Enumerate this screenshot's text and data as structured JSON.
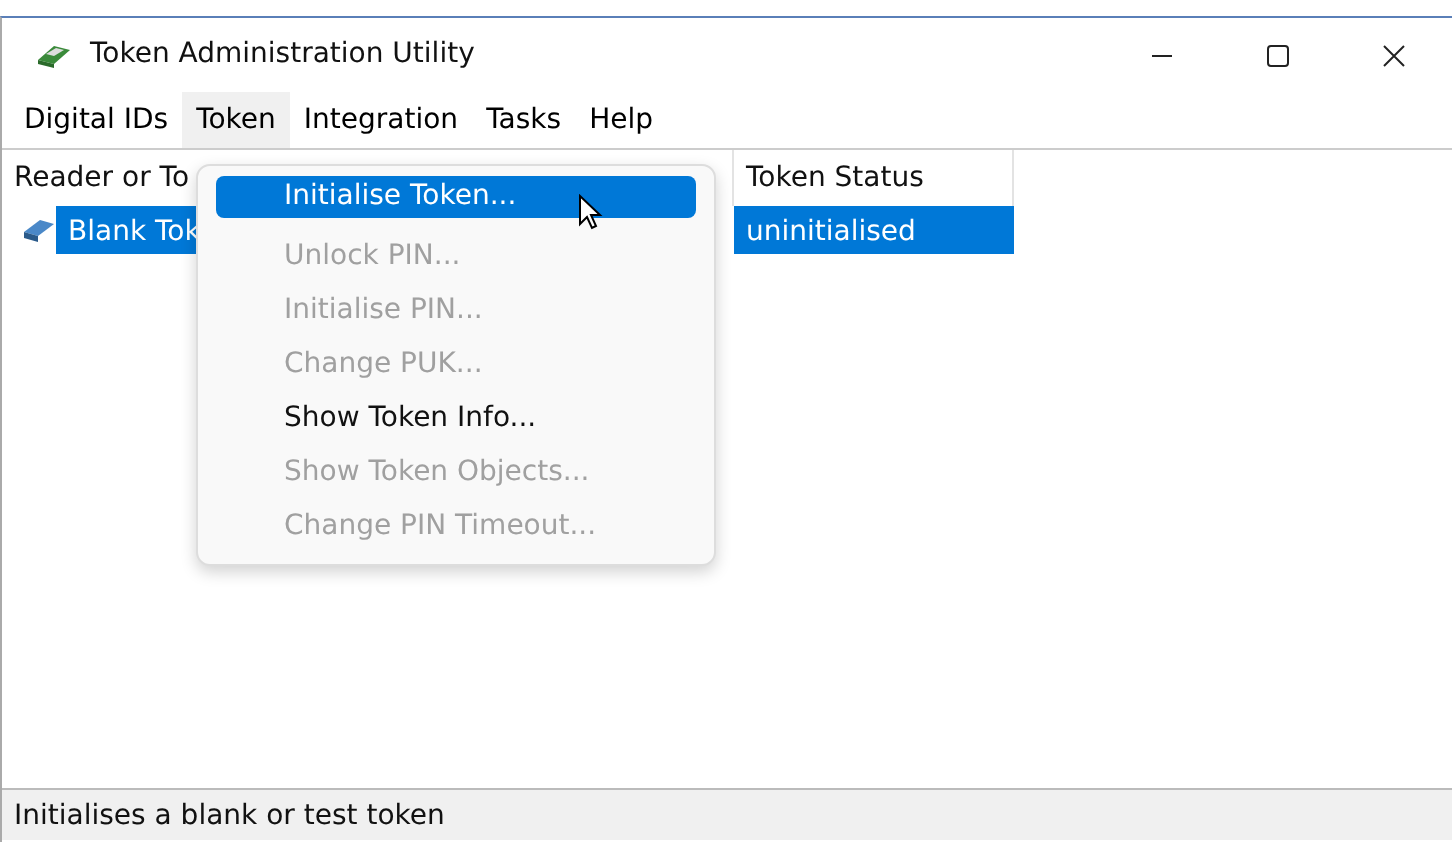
{
  "window": {
    "title": "Token Administration Utility"
  },
  "menu_bar": [
    {
      "label": "Digital IDs",
      "selected": false
    },
    {
      "label": "Token",
      "selected": true
    },
    {
      "label": "Integration",
      "selected": false
    },
    {
      "label": "Tasks",
      "selected": false
    },
    {
      "label": "Help",
      "selected": false
    }
  ],
  "table": {
    "columns": [
      "Reader or To",
      "Token Status"
    ],
    "rows": [
      {
        "cells": [
          "Blank Tok",
          "uninitialised"
        ],
        "selected": true
      }
    ]
  },
  "token_menu": [
    {
      "label": "Initialise Token...",
      "selected": true,
      "disabled": false
    },
    {
      "label": "Unlock PIN...",
      "selected": false,
      "disabled": true
    },
    {
      "label": "Initialise PIN...",
      "selected": false,
      "disabled": true
    },
    {
      "label": "Change PUK...",
      "selected": false,
      "disabled": true
    },
    {
      "label": "Show Token Info...",
      "selected": false,
      "disabled": false
    },
    {
      "label": "Show Token Objects...",
      "selected": false,
      "disabled": true
    },
    {
      "label": "Change PIN Timeout...",
      "selected": false,
      "disabled": true
    }
  ],
  "status_bar": "Initialises a blank or test token"
}
